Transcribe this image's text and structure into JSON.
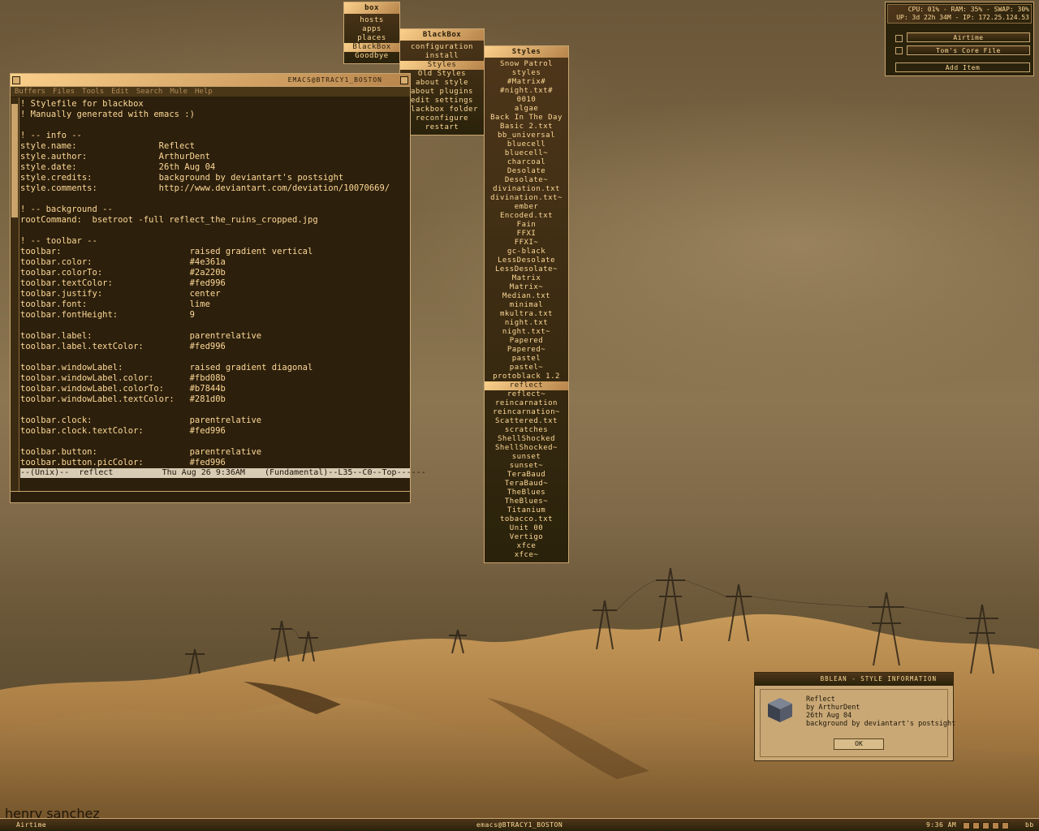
{
  "menus": {
    "root": {
      "title": "box",
      "items": [
        "hosts",
        "apps",
        "places",
        "BlackBox",
        "Goodbye"
      ],
      "selected": "BlackBox"
    },
    "blackbox": {
      "title": "BlackBox",
      "items": [
        "configuration",
        "install",
        "Styles",
        "Old Styles",
        "about style",
        "about plugins",
        "edit settings",
        "blackbox folder",
        "reconfigure",
        "restart"
      ],
      "selected": "Styles"
    },
    "styles": {
      "title": "Styles",
      "items": [
        "Snow Patrol",
        "styles",
        "#Matrix#",
        "#night.txt#",
        "0010",
        "algae",
        "Back In The Day",
        "Basic 2.txt",
        "bb_universal",
        "bluecell",
        "bluecell~",
        "charcoal",
        "Desolate",
        "Desolate~",
        "divination.txt",
        "divination.txt~",
        "ember",
        "Encoded.txt",
        "Fain",
        "FFXI",
        "FFXI~",
        "gc-black",
        "LessDesolate",
        "LessDesolate~",
        "Matrix",
        "Matrix~",
        "Median.txt",
        "minimal",
        "mkultra.txt",
        "night.txt",
        "night.txt~",
        "Papered",
        "Papered~",
        "pastel",
        "pastel~",
        "protoblack 1.2",
        "reflect",
        "reflect~",
        "reincarnation",
        "reincarnation~",
        "Scattered.txt",
        "scratches",
        "ShellShocked",
        "ShellShocked~",
        "sunset",
        "sunset~",
        "TeraBaud",
        "TeraBaud~",
        "TheBlues",
        "TheBlues~",
        "Titanium",
        "tobacco.txt",
        "Unit 00",
        "Vertigo",
        "xfce",
        "xfce~"
      ],
      "selected": "reflect"
    }
  },
  "emacs": {
    "title": "EMACS@BTRACY1_BOSTON",
    "menubar": [
      "Buffers",
      "Files",
      "Tools",
      "Edit",
      "Search",
      "Mule",
      "Help"
    ],
    "lines": [
      "! Stylefile for blackbox",
      "! Manually generated with emacs :)",
      "",
      "! -- info --",
      "style.name:                Reflect",
      "style.author:              ArthurDent",
      "style.date:                26th Aug 04",
      "style.credits:             background by deviantart's postsight",
      "style.comments:            http://www.deviantart.com/deviation/10070669/",
      "",
      "! -- background --",
      "rootCommand:  bsetroot -full reflect_the_ruins_cropped.jpg",
      "",
      "! -- toolbar --",
      "toolbar:                         raised gradient vertical",
      "toolbar.color:                   #4e361a",
      "toolbar.colorTo:                 #2a220b",
      "toolbar.textColor:               #fed996",
      "toolbar.justify:                 center",
      "toolbar.font:                    lime",
      "toolbar.fontHeight:              9",
      "",
      "toolbar.label:                   parentrelative",
      "toolbar.label.textColor:         #fed996",
      "",
      "toolbar.windowLabel:             raised gradient diagonal",
      "toolbar.windowLabel.color:       #fbd08b",
      "toolbar.windowLabel.colorTo:     #b7844b",
      "toolbar.windowLabel.textColor:   #281d0b",
      "",
      "toolbar.clock:                   parentrelative",
      "toolbar.clock.textColor:         #fed996",
      "",
      "toolbar.button:                  parentrelative",
      "toolbar.button.picColor:         #fed996"
    ],
    "modeline": "--(Unix)--  reflect          Thu Aug 26 9:36AM    (Fundamental)--L35--C0--Top------"
  },
  "sysbox": {
    "stats_line1": "CPU: 01% - RAM: 35% - SWAP: 30%",
    "stats_line2": "UP: 3d 22h 34M - IP: 172.25.124.53",
    "tasks": [
      "Airtime",
      "Tom's Core File"
    ],
    "add_label": "Add Item"
  },
  "dialog": {
    "title": "BBLEAN - STYLE INFORMATION",
    "lines": [
      "Reflect",
      "by ArthurDent",
      "26th Aug 04",
      "background by deviantart's postsight"
    ],
    "ok_label": "OK"
  },
  "toolbar": {
    "left_label": "Airtime",
    "window_label": "emacs@BTRACY1_BOSTON",
    "clock": "9:36 AM",
    "bb_label": "bb"
  },
  "signature": "henry sanchez",
  "colors": {
    "toolbar": "#4e361a",
    "toolbar_to": "#2a220b",
    "text": "#fed996",
    "label": "#fbd08b",
    "label_to": "#b7844b",
    "label_text": "#281d0b"
  }
}
